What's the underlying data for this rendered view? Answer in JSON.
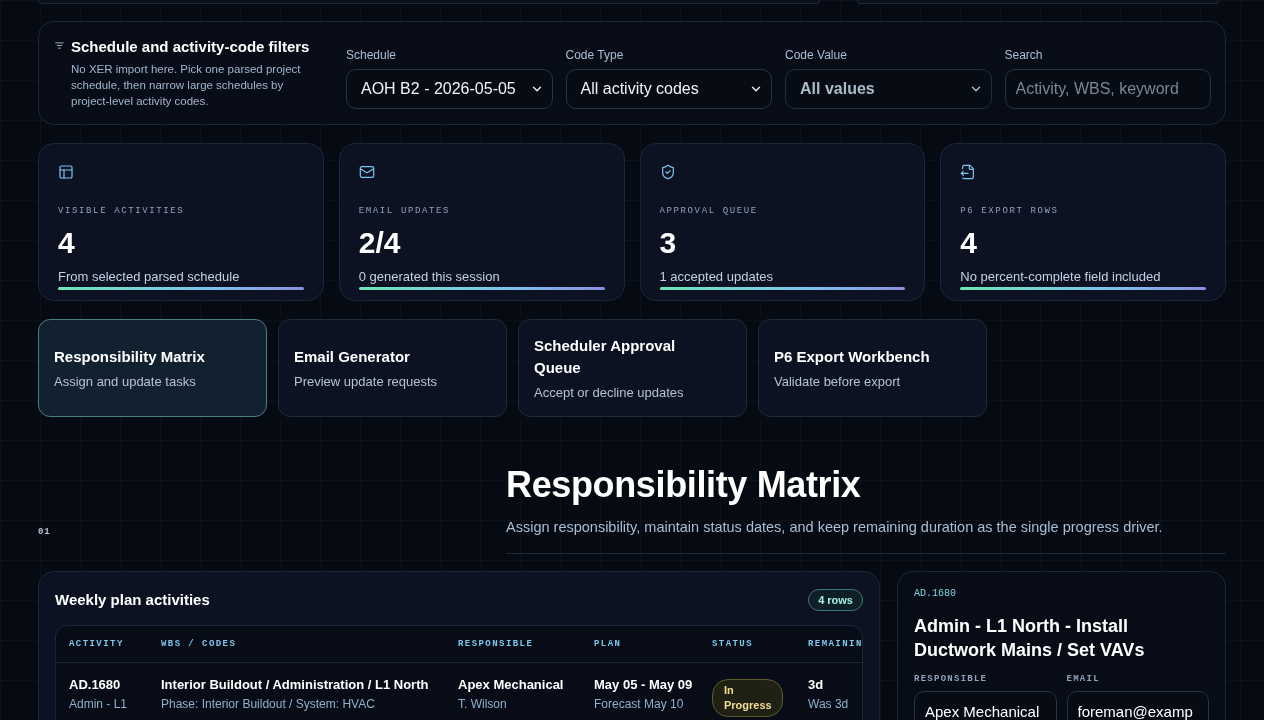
{
  "filters": {
    "title": "Schedule and activity-code filters",
    "description": "No XER import here. Pick one parsed project schedule, then narrow large schedules by project-level activity codes.",
    "fields": [
      {
        "kind": "select",
        "label": "Schedule",
        "value": "AOH B2 - 2026-05-05",
        "disabled": false
      },
      {
        "kind": "select",
        "label": "Code Type",
        "value": "All activity codes",
        "disabled": false
      },
      {
        "kind": "select",
        "label": "Code Value",
        "value": "All values",
        "disabled": true
      },
      {
        "kind": "search",
        "label": "Search",
        "placeholder": "Activity, WBS, keyword",
        "disabled": false
      }
    ]
  },
  "stats": [
    {
      "label": "VISIBLE ACTIVITIES",
      "value": "4",
      "note": "From selected parsed schedule"
    },
    {
      "label": "EMAIL UPDATES",
      "value": "2/4",
      "note": "0 generated this session"
    },
    {
      "label": "APPROVAL QUEUE",
      "value": "3",
      "note": "1 accepted updates"
    },
    {
      "label": "P6 EXPORT ROWS",
      "value": "4",
      "note": "No percent-complete field included"
    }
  ],
  "modules": [
    {
      "title": "Responsibility Matrix",
      "subtitle": "Assign and update tasks",
      "selected": true
    },
    {
      "title": "Email Generator",
      "subtitle": "Preview update requests",
      "selected": false
    },
    {
      "title": "Scheduler Approval Queue",
      "subtitle": "Accept or decline updates",
      "selected": false
    },
    {
      "title": "P6 Export Workbench",
      "subtitle": "Validate before export",
      "selected": false
    }
  ],
  "section": {
    "number": "01",
    "title": "Responsibility Matrix",
    "subtitle": "Assign responsibility, maintain status dates, and keep remaining duration as the single progress driver."
  },
  "activities_table": {
    "title": "Weekly plan activities",
    "count": "4 rows",
    "columns": [
      "ACTIVITY",
      "WBS / CODES",
      "RESPONSIBLE",
      "PLAN",
      "STATUS",
      "REMAININ"
    ],
    "rows": [
      {
        "activity": {
          "id": "AD.1680",
          "name": "Admin - L1"
        },
        "wbs": {
          "path": "Interior Buildout / Administration / L1 North",
          "codes": "Phase: Interior Buildout / System: HVAC"
        },
        "responsible": {
          "company": "Apex Mechanical",
          "person": "T. Wilson"
        },
        "plan": {
          "dates": "May 05 - May 09",
          "forecast": "Forecast May 10"
        },
        "status": "In Progress",
        "remaining": {
          "value": "3d",
          "was": "Was 3d"
        }
      }
    ]
  },
  "detail": {
    "id": "AD.1680",
    "title": "Admin - L1 North - Install Ductwork Mains / Set VAVs",
    "fields": [
      {
        "label": "RESPONSIBLE",
        "value": "Apex Mechanical"
      },
      {
        "label": "EMAIL",
        "value": "foreman@examp"
      }
    ]
  }
}
